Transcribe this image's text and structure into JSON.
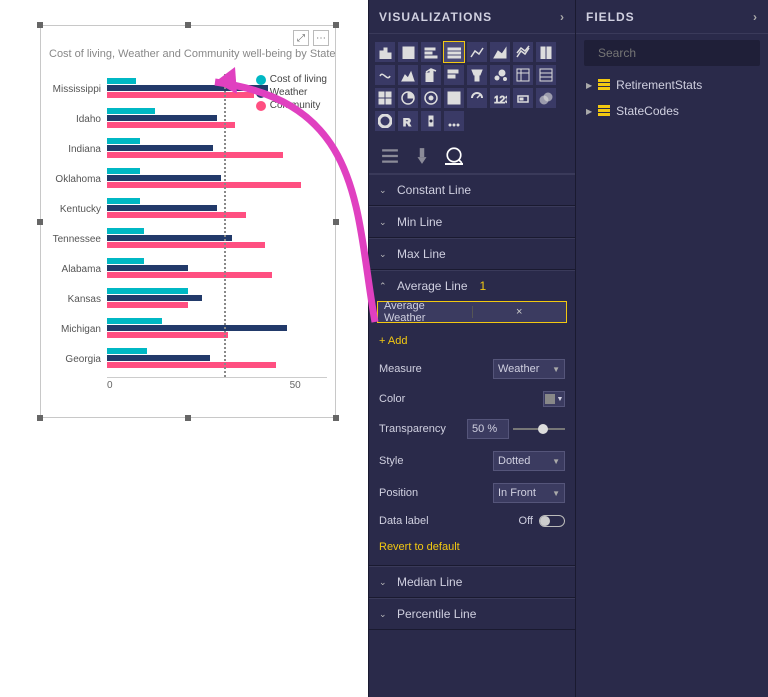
{
  "panels": {
    "visualizations": "VISUALIZATIONS",
    "fields": "FIELDS"
  },
  "search": {
    "placeholder": "Search"
  },
  "fields_list": [
    {
      "name": "RetirementStats"
    },
    {
      "name": "StateCodes"
    }
  ],
  "gallery_selected_index": 3,
  "format_tabs": {
    "active": "analytics"
  },
  "cards": {
    "constant": "Constant Line",
    "min": "Min Line",
    "max": "Max Line",
    "average": "Average Line",
    "average_count": "1",
    "median": "Median Line",
    "percentile": "Percentile Line"
  },
  "avg_line": {
    "item_name": "Average Weather",
    "add": "+ Add",
    "measure_label": "Measure",
    "measure_value": "Weather",
    "color_label": "Color",
    "transparency_label": "Transparency",
    "transparency_value": "50",
    "transparency_unit": "%",
    "style_label": "Style",
    "style_value": "Dotted",
    "position_label": "Position",
    "position_value": "In Front",
    "datalabel_label": "Data label",
    "datalabel_value": "Off",
    "revert": "Revert to default"
  },
  "chart": {
    "title": "Cost of living, Weather and Community well-being by State",
    "legend": [
      "Cost of living",
      "Weather",
      "Community"
    ],
    "colors": {
      "cost": "#00b8c4",
      "weather": "#223a6a",
      "community": "#ff4f81"
    },
    "ticks": [
      "0",
      "50"
    ],
    "avg_value": 32
  },
  "chart_data": {
    "type": "bar",
    "orientation": "horizontal",
    "title": "Cost of living, Weather and Community well-being by State",
    "xlabel": "",
    "ylabel": "",
    "xlim": [
      0,
      60
    ],
    "categories": [
      "Mississippi",
      "Idaho",
      "Indiana",
      "Oklahoma",
      "Kentucky",
      "Tennessee",
      "Alabama",
      "Kansas",
      "Michigan",
      "Georgia"
    ],
    "series": [
      {
        "name": "Cost of living",
        "color": "#00b8c4",
        "values": [
          8,
          13,
          9,
          9,
          9,
          10,
          10,
          22,
          15,
          11
        ]
      },
      {
        "name": "Weather",
        "color": "#223a6a",
        "values": [
          44,
          30,
          29,
          31,
          30,
          34,
          22,
          26,
          49,
          28
        ]
      },
      {
        "name": "Community",
        "color": "#ff4f81",
        "values": [
          40,
          35,
          48,
          53,
          38,
          43,
          45,
          22,
          33,
          46
        ]
      }
    ],
    "reference_lines": [
      {
        "name": "Average Weather",
        "value": 32,
        "style": "dotted",
        "color": "#888888"
      }
    ],
    "legend_position": "top-right"
  }
}
